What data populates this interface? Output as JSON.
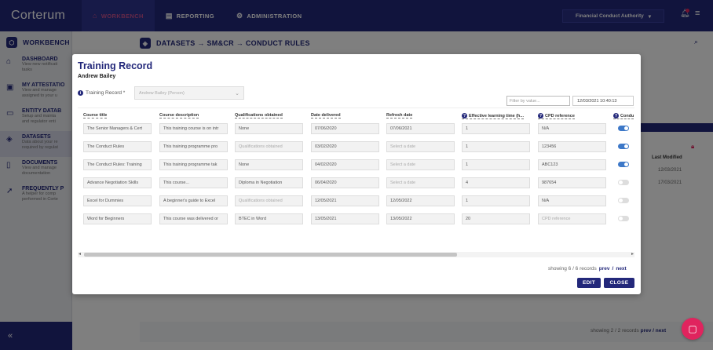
{
  "app": {
    "logo": "Corterum",
    "nav": [
      {
        "label": "WORKBENCH",
        "icon": "home-icon"
      },
      {
        "label": "REPORTING",
        "icon": "chart-icon"
      },
      {
        "label": "ADMINISTRATION",
        "icon": "gear-icon"
      }
    ],
    "org": "Financial Conduct Authority"
  },
  "sidebar": {
    "title": "WORKBENCH",
    "items": [
      {
        "title": "DASHBOARD",
        "desc1": "View new notificati",
        "desc2": "tasks",
        "icon": "home-icon"
      },
      {
        "title": "MY ATTESTATIO",
        "desc1": "View and manage",
        "desc2": "assigned to your u",
        "icon": "clipboard-icon"
      },
      {
        "title": "ENTITY DATAB",
        "desc1": "Setup and mainta",
        "desc2": "and regulator enti",
        "icon": "folder-icon"
      },
      {
        "title": "DATASETS",
        "desc1": "Data about your re",
        "desc2": "required by regulat",
        "icon": "layers-icon"
      },
      {
        "title": "DOCUMENTS",
        "desc1": "View and manage",
        "desc2": "documentation",
        "icon": "document-icon"
      },
      {
        "title": "FREQUENTLY P",
        "desc1": "A helper for comp",
        "desc2": "performed in Corte",
        "icon": "rocket-icon"
      }
    ],
    "collapse": "«"
  },
  "main": {
    "breadcrumb": "DATASETS → SM&CR → CONDUCT RULES",
    "last_modified_header": "Last Modified",
    "dates": [
      "12/03/2021",
      "17/03/2021"
    ],
    "footer_showing": "showing 2 / 2 records",
    "prev": "prev",
    "next": "next",
    "slash": "/"
  },
  "modal": {
    "title": "Training Record",
    "subtitle": "Andrew Bailey",
    "field_label": "Training Record *",
    "select_value": "Andrew Bailey (Person)",
    "filter_placeholder": "Filter by value...",
    "date_value": "12/03/2021 10:40:13",
    "columns": [
      "Course title",
      "Course description",
      "Qualifications obtained",
      "Date delivered",
      "Refresh date",
      "Effective learning time (h...",
      "CPD reference",
      "Condu"
    ],
    "rows": [
      {
        "title": "The Senior Managers & Cert",
        "desc": "This training course is on intr",
        "qual": "None",
        "qual_ph": false,
        "delivered": "07/06/2020",
        "refresh": "07/06/2021",
        "refresh_ph": false,
        "time": "1",
        "cpd": "N/A",
        "cpd_ph": false,
        "conduct": true
      },
      {
        "title": "The Conduct Rules",
        "desc": "This training programme pro",
        "qual": "Qualifications obtained",
        "qual_ph": true,
        "delivered": "03/02/2020",
        "refresh": "Select a date",
        "refresh_ph": true,
        "time": "1",
        "cpd": "123456",
        "cpd_ph": false,
        "conduct": true
      },
      {
        "title": "The Conduct Rules: Training",
        "desc": "This training programme tak",
        "qual": "None",
        "qual_ph": false,
        "delivered": "04/02/2020",
        "refresh": "Select a date",
        "refresh_ph": true,
        "time": "1",
        "cpd": "ABC123",
        "cpd_ph": false,
        "conduct": true
      },
      {
        "title": "Advance Negotiation Skills",
        "desc": "This course...",
        "qual": "Diploma in Negotiation",
        "qual_ph": false,
        "delivered": "06/04/2020",
        "refresh": "Select a date",
        "refresh_ph": true,
        "time": "4",
        "cpd": "987654",
        "cpd_ph": false,
        "conduct": false
      },
      {
        "title": "Excel for Dummies",
        "desc": "A beginner's guide to Excel",
        "qual": "Qualifications obtained",
        "qual_ph": true,
        "delivered": "12/05/2021",
        "refresh": "12/05/2022",
        "refresh_ph": false,
        "time": "1",
        "cpd": "N/A",
        "cpd_ph": false,
        "conduct": false
      },
      {
        "title": "Word for Beginners",
        "desc": "This course was delivered or",
        "qual": "BTEC in Word",
        "qual_ph": false,
        "delivered": "13/05/2021",
        "refresh": "13/05/2022",
        "refresh_ph": false,
        "time": "20",
        "cpd": "CPD reference",
        "cpd_ph": true,
        "conduct": false
      }
    ],
    "showing": "showing 6 / 6 records",
    "prev": "prev",
    "next": "next",
    "slash": "/",
    "edit": "EDIT",
    "close": "CLOSE"
  }
}
